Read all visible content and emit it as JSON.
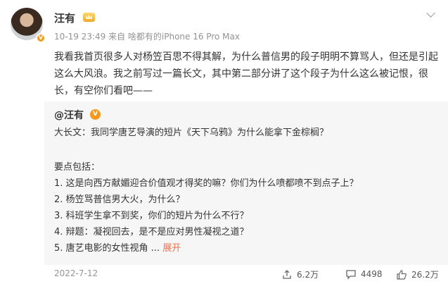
{
  "post": {
    "author": "汪有",
    "meta": "10-19 23:49  来自 啥都有的iPhone 16 Pro Max",
    "text": "我看我首页很多人对杨笠百思不得其解，为什么普信男的段子明明不算骂人，但还是引起这么大风浪。我之前写过一篇长文，其中第二部分讲了这个段子为什么这么被记恨，很长，有空你们看吧——"
  },
  "quoted": {
    "author": "@汪有",
    "lines": [
      "大长文：我同学唐艺导演的短片《天下乌鸦》为什么能拿下金棕榈？",
      "要点包括：",
      "1. 这是向西方献媚迎合价值观才得奖的嘛？你们为什么喷都喷不到点子上？",
      "2. 杨笠骂普信男大火，为什么？",
      "3. 科班学生拿不到奖，你们的短片为什么不行？",
      "4. 辩题：凝视回去，是不是应对男性凝视之道？",
      "5. 唐艺电影的女性视角 ..."
    ],
    "expand_label": "展开",
    "date": "2022-7-12",
    "reposts": "6.2万",
    "comments": "4498",
    "likes": "26.2万"
  }
}
